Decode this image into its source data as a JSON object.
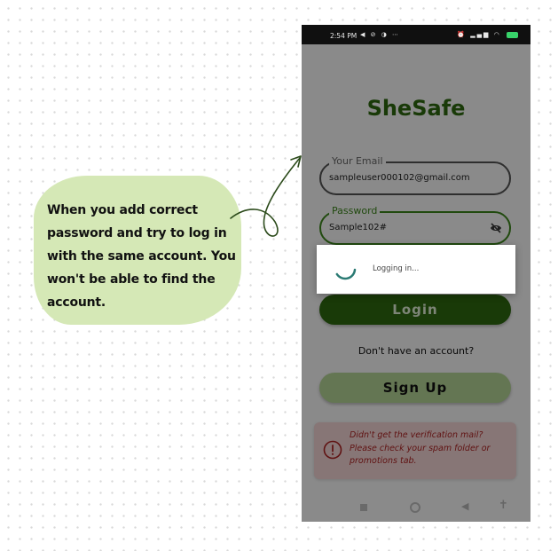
{
  "annotation": {
    "lines": [
      "When you add correct",
      "password and try to log in",
      "with the same account. You",
      "won't be able to find the",
      "account."
    ]
  },
  "status_bar": {
    "time": "2:54 PM",
    "battery": "86"
  },
  "app": {
    "title": "SheSafe",
    "email_field": {
      "label": "Your Email",
      "value": "sampleuser000102@gmail.com"
    },
    "password_field": {
      "label": "Password",
      "value": "Sample102#"
    },
    "login_button": "Login",
    "signup_prompt": "Don't have an account?",
    "signup_button": "Sign Up",
    "notice": {
      "lines": [
        "Didn't get the verification mail?",
        "Please check your spam folder or",
        "promotions tab."
      ]
    }
  },
  "loading_dialog": {
    "message": "Logging in..."
  },
  "colors": {
    "brand_green": "#2f6b10",
    "light_green": "#b9db99",
    "bubble_green": "#d5e8b6",
    "notice_red": "#b22424",
    "notice_bg": "#f9dada"
  },
  "icons": [
    "arrow-annotation-icon",
    "eye-off-icon",
    "info-icon",
    "spinner-icon",
    "wifi-icon",
    "signal-icon",
    "alarm-icon",
    "accessibility-icon"
  ]
}
